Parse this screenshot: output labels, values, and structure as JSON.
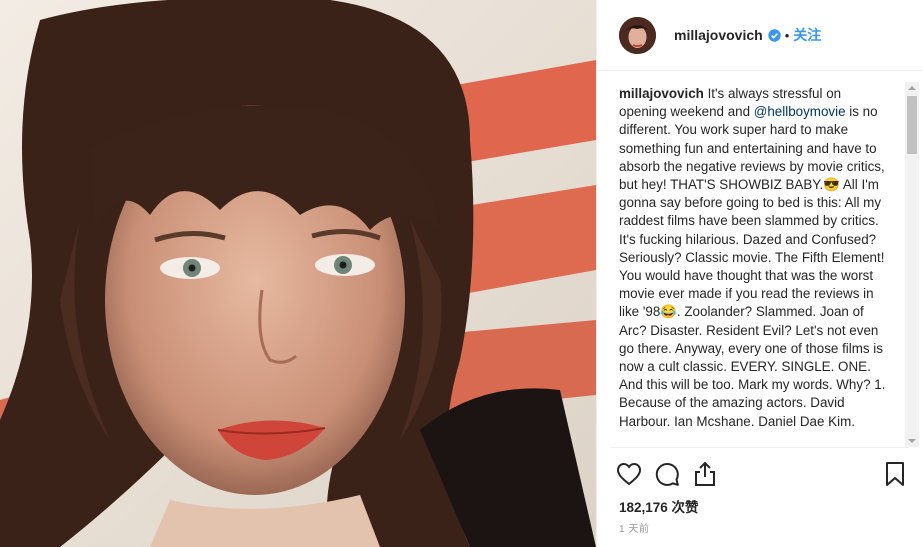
{
  "post": {
    "username": "millajovovich",
    "follow_label": "关注",
    "dot": "•",
    "caption_user": "millajovovich",
    "caption_1": " It's always stressful on opening weekend and ",
    "mention": "@hellboymovie",
    "caption_2": " is no different. You work super hard to make something fun and entertaining and have to absorb the negative reviews by movie critics, but hey! THAT'S SHOWBIZ BABY.😎 All I'm gonna say before going to bed is this: All my raddest films have been slammed by critics. It's fucking hilarious. Dazed and Confused? Seriously? Classic movie. The Fifth Element! You would have thought that was the worst movie ever made if you read the reviews in like '98😂. Zoolander? Slammed. Joan of Arc? Disaster. Resident Evil? Let's not even go there. Anyway, every one of those films is now a cult classic. EVERY. SINGLE. ONE. And this will be too. Mark my words. Why? 1. Because of the amazing actors. David Harbour. Ian Mcshane. Daniel Dae Kim.",
    "likes": "182,176 次赞",
    "time": "1 天前"
  },
  "icons": {
    "verified": "verified-badge-icon",
    "like": "heart-icon",
    "comment": "comment-icon",
    "share": "share-icon",
    "save": "bookmark-icon"
  },
  "colors": {
    "follow": "#3897f0",
    "verified": "#3897f0",
    "mention": "#003569"
  }
}
